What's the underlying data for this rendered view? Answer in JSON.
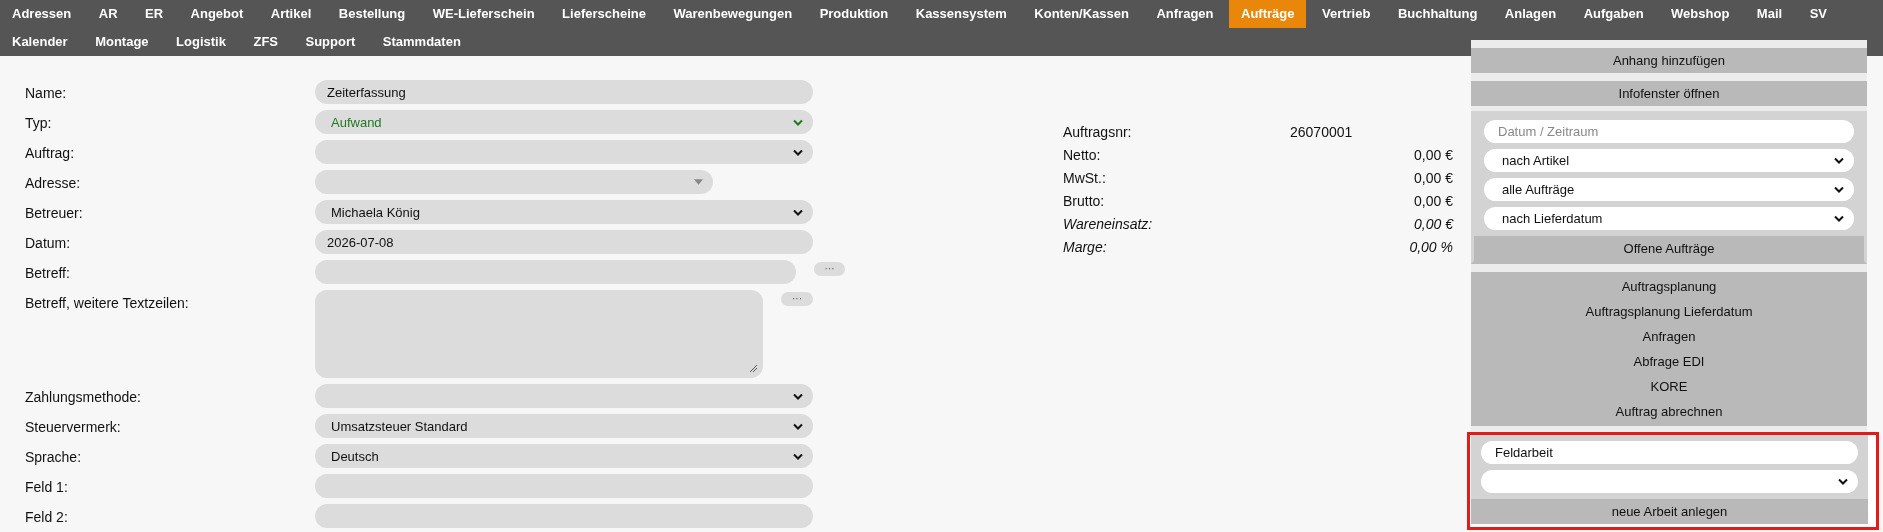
{
  "nav": [
    [
      {
        "label": "Adressen",
        "selected": false
      },
      {
        "label": "AR",
        "selected": false
      },
      {
        "label": "ER",
        "selected": false
      },
      {
        "label": "Angebot",
        "selected": false
      },
      {
        "label": "Artikel",
        "selected": false
      },
      {
        "label": "Bestellung",
        "selected": false
      },
      {
        "label": "WE-Lieferschein",
        "selected": false
      },
      {
        "label": "Lieferscheine",
        "selected": false
      },
      {
        "label": "Warenbewegungen",
        "selected": false
      },
      {
        "label": "Produktion",
        "selected": false
      },
      {
        "label": "Kassensystem",
        "selected": false
      },
      {
        "label": "Konten/Kassen",
        "selected": false
      },
      {
        "label": "Anfragen",
        "selected": false
      },
      {
        "label": "Aufträge",
        "selected": true
      },
      {
        "label": "Vertrieb",
        "selected": false
      },
      {
        "label": "Buchhaltung",
        "selected": false
      },
      {
        "label": "Anlagen",
        "selected": false
      },
      {
        "label": "Aufgaben",
        "selected": false
      },
      {
        "label": "Webshop",
        "selected": false
      },
      {
        "label": "Mail",
        "selected": false
      },
      {
        "label": "SV",
        "selected": false
      }
    ],
    [
      {
        "label": "Kalender",
        "selected": false
      },
      {
        "label": "Montage",
        "selected": false
      },
      {
        "label": "Logistik",
        "selected": false
      },
      {
        "label": "ZFS",
        "selected": false
      },
      {
        "label": "Support",
        "selected": false
      },
      {
        "label": "Stammdaten",
        "selected": false
      }
    ]
  ],
  "form": [
    {
      "label": "Name:",
      "kind": "text",
      "value": "Zeiterfassung"
    },
    {
      "label": "Typ:",
      "kind": "select",
      "value": "Aufwand",
      "valid": true
    },
    {
      "label": "Auftrag:",
      "kind": "select",
      "valid": false
    },
    {
      "label": "Adresse:",
      "kind": "combo"
    },
    {
      "label": "Betreuer:",
      "kind": "select",
      "value": "Michaela König",
      "valid": false
    },
    {
      "label": "Datum:",
      "kind": "text",
      "value": "2026-07-08"
    },
    {
      "label": "Betreff:",
      "kind": "text",
      "extra_button": "···"
    },
    {
      "label": "Betreff, weitere Textzeilen:",
      "kind": "textarea",
      "extra_button": "···"
    },
    {
      "label": "Zahlungsmethode:",
      "kind": "select",
      "valid": false
    },
    {
      "label": "Steuervermerk:",
      "kind": "select",
      "value": "Umsatzsteuer Standard",
      "valid": false
    },
    {
      "label": "Sprache:",
      "kind": "select",
      "value": "Deutsch",
      "valid": false
    },
    {
      "label": "Feld 1:",
      "kind": "text"
    },
    {
      "label": "Feld 2:",
      "kind": "text"
    }
  ],
  "summary": [
    {
      "label": "Auftragsnr:",
      "value": "26070001",
      "kind": "number",
      "italic": false
    },
    {
      "label": "Netto:",
      "value": "0,00 €",
      "kind": "amount",
      "italic": false
    },
    {
      "label": "MwSt.:",
      "value": "0,00 €",
      "kind": "amount",
      "italic": false
    },
    {
      "label": "Brutto:",
      "value": "0,00 €",
      "kind": "amount",
      "italic": false
    },
    {
      "label": "Wareneinsatz:",
      "value": "0,00 €",
      "kind": "amount",
      "italic": true
    },
    {
      "label": "Marge:",
      "value": "0,00 %",
      "kind": "amount",
      "italic": true
    }
  ],
  "sidebar": [
    {
      "kind": "button",
      "label": "Anhang hinzufügen"
    },
    {
      "kind": "button",
      "label": "Infofenster öffnen"
    },
    {
      "kind": "filters",
      "highlighted": false,
      "fields": [
        {
          "kind": "text",
          "placeholder": "Datum / Zeitraum"
        },
        {
          "kind": "select",
          "value": "nach Artikel"
        },
        {
          "kind": "select",
          "value": "alle Aufträge"
        },
        {
          "kind": "select",
          "value": "nach Lieferdatum"
        }
      ],
      "button": "Offene Aufträge"
    },
    {
      "kind": "links",
      "items": [
        "Auftragsplanung",
        "Auftragsplanung Lieferdatum",
        "Anfragen",
        "Abfrage EDI",
        "KORE",
        "Auftrag abrechnen"
      ]
    },
    {
      "kind": "filters",
      "highlighted": true,
      "fields": [
        {
          "kind": "text",
          "value": "Feldarbeit"
        },
        {
          "kind": "select"
        }
      ],
      "button": "neue Arbeit anlegen"
    }
  ]
}
